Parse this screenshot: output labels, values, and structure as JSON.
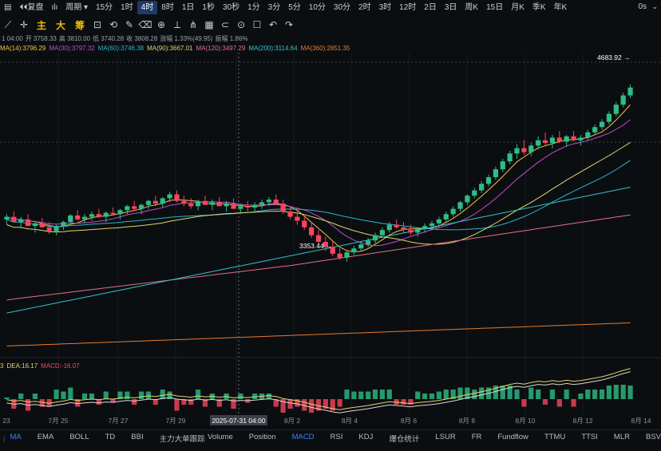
{
  "toolbar": {
    "menu_icon": "menu-icon",
    "restore_label": "复盘",
    "candle_type_label": "ılı",
    "period_label": "周期",
    "intervals": [
      "15分",
      "1时",
      "4时",
      "8时",
      "1日",
      "1秒",
      "30秒",
      "1分",
      "3分",
      "5分",
      "10分",
      "30分",
      "2时",
      "3时",
      "12时",
      "2日",
      "3日",
      "周K",
      "15日",
      "月K",
      "季K",
      "年K"
    ],
    "active_interval": "4时",
    "timer_label": "0s"
  },
  "tools": {
    "indicator_buttons": [
      "主",
      "大",
      "筹"
    ]
  },
  "ohlc": {
    "time": "1 04:00",
    "open": "开 3758.33",
    "high": "高 3810.00",
    "low": "低 3740.28",
    "close": "收 3808.28",
    "change": "涨幅 1.33%(49.95)",
    "amplitude": "振幅 1.86%"
  },
  "ma_legend": [
    {
      "text": "MA(14):3796.29",
      "color": "#f5c242"
    },
    {
      "text": "MA(30):3797.32",
      "color": "#c04bd1"
    },
    {
      "text": "MA(60):3746.38",
      "color": "#2bb3c9"
    },
    {
      "text": "MA(90):3667.01",
      "color": "#e3d46b"
    },
    {
      "text": "MA(120):3497.29",
      "color": "#e26f8a"
    },
    {
      "text": "MA(200):3114.64",
      "color": "#35c0c8"
    },
    {
      "text": "MA(360):2851.35",
      "color": "#e67a2e"
    }
  ],
  "macd_legend": {
    "prefix": "3",
    "dea": "DEA:16.17",
    "macd": "MACD:-16.07"
  },
  "chart_data": {
    "type": "candlestick",
    "x_tick_labels": [
      "23",
      "7月 25",
      "7月 27",
      "7月 29",
      "2025-07-31 04:00",
      "8月 2",
      "8月 4",
      "8月 6",
      "8月 8",
      "8月 10",
      "8月 12",
      "8月 14"
    ],
    "crosshair_label": "2025-07-31 04:00",
    "annotations": [
      {
        "text": "4683.92 →",
        "value": 4683.92
      },
      {
        "text": "3353.44 →",
        "value": 3353.44
      }
    ],
    "price_range": [
      2600,
      4900
    ],
    "candles": [
      [
        3660,
        3700,
        3620,
        3680
      ],
      [
        3680,
        3720,
        3650,
        3640
      ],
      [
        3640,
        3680,
        3590,
        3660
      ],
      [
        3660,
        3700,
        3620,
        3610
      ],
      [
        3610,
        3650,
        3560,
        3630
      ],
      [
        3630,
        3670,
        3600,
        3600
      ],
      [
        3600,
        3640,
        3550,
        3570
      ],
      [
        3570,
        3620,
        3540,
        3610
      ],
      [
        3610,
        3650,
        3580,
        3640
      ],
      [
        3640,
        3700,
        3620,
        3690
      ],
      [
        3690,
        3730,
        3650,
        3660
      ],
      [
        3660,
        3700,
        3630,
        3680
      ],
      [
        3680,
        3720,
        3650,
        3700
      ],
      [
        3700,
        3740,
        3670,
        3680
      ],
      [
        3680,
        3720,
        3640,
        3710
      ],
      [
        3710,
        3750,
        3690,
        3700
      ],
      [
        3700,
        3740,
        3660,
        3730
      ],
      [
        3730,
        3770,
        3700,
        3760
      ],
      [
        3760,
        3800,
        3720,
        3740
      ],
      [
        3740,
        3780,
        3700,
        3770
      ],
      [
        3770,
        3810,
        3740,
        3800
      ],
      [
        3800,
        3840,
        3760,
        3780
      ],
      [
        3780,
        3830,
        3750,
        3820
      ],
      [
        3820,
        3870,
        3790,
        3850
      ],
      [
        3850,
        3880,
        3790,
        3800
      ],
      [
        3800,
        3840,
        3760,
        3780
      ],
      [
        3780,
        3820,
        3740,
        3760
      ],
      [
        3760,
        3810,
        3730,
        3800
      ],
      [
        3800,
        3840,
        3770,
        3770
      ],
      [
        3770,
        3810,
        3730,
        3790
      ],
      [
        3790,
        3830,
        3760,
        3760
      ],
      [
        3760,
        3800,
        3720,
        3780
      ],
      [
        3780,
        3820,
        3740,
        3740
      ],
      [
        3740,
        3780,
        3700,
        3760
      ],
      [
        3760,
        3800,
        3720,
        3750
      ],
      [
        3750,
        3790,
        3710,
        3770
      ],
      [
        3770,
        3810,
        3740,
        3790
      ],
      [
        3790,
        3830,
        3760,
        3810
      ],
      [
        3810,
        3850,
        3780,
        3780
      ],
      [
        3780,
        3810,
        3700,
        3720
      ],
      [
        3720,
        3760,
        3660,
        3680
      ],
      [
        3680,
        3720,
        3620,
        3650
      ],
      [
        3650,
        3690,
        3580,
        3600
      ],
      [
        3600,
        3640,
        3520,
        3540
      ],
      [
        3540,
        3580,
        3470,
        3490
      ],
      [
        3490,
        3530,
        3420,
        3450
      ],
      [
        3450,
        3490,
        3380,
        3400
      ],
      [
        3400,
        3440,
        3353,
        3370
      ],
      [
        3370,
        3420,
        3340,
        3410
      ],
      [
        3410,
        3460,
        3390,
        3440
      ],
      [
        3440,
        3490,
        3420,
        3470
      ],
      [
        3470,
        3520,
        3450,
        3500
      ],
      [
        3500,
        3560,
        3480,
        3540
      ],
      [
        3540,
        3600,
        3520,
        3580
      ],
      [
        3580,
        3640,
        3560,
        3620
      ],
      [
        3620,
        3660,
        3590,
        3600
      ],
      [
        3600,
        3640,
        3560,
        3580
      ],
      [
        3580,
        3620,
        3540,
        3560
      ],
      [
        3560,
        3600,
        3530,
        3590
      ],
      [
        3590,
        3630,
        3560,
        3610
      ],
      [
        3610,
        3650,
        3580,
        3630
      ],
      [
        3630,
        3680,
        3600,
        3660
      ],
      [
        3660,
        3720,
        3640,
        3700
      ],
      [
        3700,
        3760,
        3680,
        3740
      ],
      [
        3740,
        3800,
        3720,
        3790
      ],
      [
        3790,
        3850,
        3770,
        3840
      ],
      [
        3840,
        3900,
        3820,
        3880
      ],
      [
        3880,
        3950,
        3860,
        3930
      ],
      [
        3930,
        4000,
        3910,
        3980
      ],
      [
        3980,
        4060,
        3960,
        4040
      ],
      [
        4040,
        4120,
        4020,
        4100
      ],
      [
        4100,
        4180,
        4080,
        4160
      ],
      [
        4160,
        4230,
        4120,
        4200
      ],
      [
        4200,
        4260,
        4150,
        4170
      ],
      [
        4170,
        4240,
        4140,
        4220
      ],
      [
        4220,
        4290,
        4190,
        4260
      ],
      [
        4260,
        4320,
        4220,
        4240
      ],
      [
        4240,
        4300,
        4200,
        4280
      ],
      [
        4280,
        4330,
        4240,
        4250
      ],
      [
        4250,
        4300,
        4210,
        4290
      ],
      [
        4290,
        4330,
        4250,
        4260
      ],
      [
        4260,
        4300,
        4220,
        4280
      ],
      [
        4280,
        4340,
        4260,
        4320
      ],
      [
        4320,
        4380,
        4300,
        4360
      ],
      [
        4360,
        4420,
        4340,
        4400
      ],
      [
        4400,
        4480,
        4380,
        4460
      ],
      [
        4460,
        4550,
        4440,
        4530
      ],
      [
        4530,
        4620,
        4510,
        4600
      ],
      [
        4600,
        4684,
        4580,
        4660
      ]
    ],
    "series": [
      {
        "name": "MA(14)",
        "color": "#f5c242"
      },
      {
        "name": "MA(30)",
        "color": "#c04bd1"
      },
      {
        "name": "MA(60)",
        "color": "#2bb3c9"
      },
      {
        "name": "MA(90)",
        "color": "#e3d46b"
      },
      {
        "name": "MA(120)",
        "color": "#e26f8a"
      },
      {
        "name": "MA(200)",
        "color": "#35c0c8"
      },
      {
        "name": "MA(360)",
        "color": "#e67a2e"
      }
    ],
    "colors": {
      "up": "#2ebd85",
      "down": "#f6465d"
    }
  },
  "bottom_tabs": {
    "main": [
      "MA",
      "EMA",
      "BOLL",
      "TD",
      "BBI",
      "主力大单跟踪"
    ],
    "sub": [
      "Volume",
      "Position",
      "MACD",
      "RSI",
      "KDJ",
      "爆仓统计",
      "LSUR",
      "FR",
      "Fundflow",
      "TTMU",
      "TTSI",
      "MLR",
      "BSV"
    ],
    "active_main": "MA",
    "active_sub": "MACD"
  }
}
